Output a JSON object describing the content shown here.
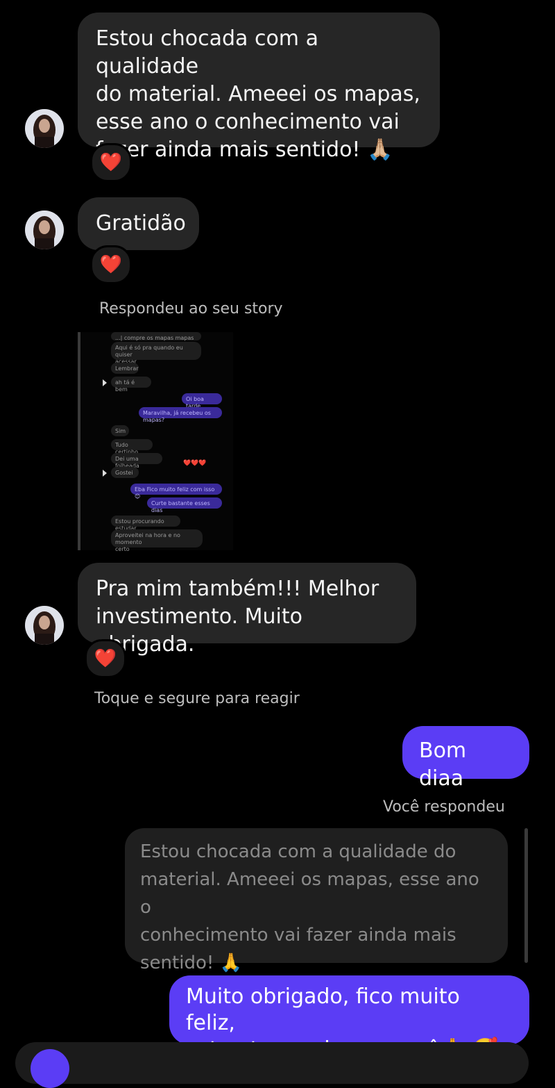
{
  "messages": {
    "m1": "Estou chocada com a qualidade\ndo material. Ameeei os mapas,\nesse ano o conhecimento vai\nfazer ainda mais sentido! 🙏🏼",
    "m2": "Gratidão",
    "m3": "Pra mim também!!! Melhor\ninvestimento. Muito obrigada.",
    "out1": "Bom diaa",
    "out2": "Muito obrigado, fico muito feliz,\nestou torcendo por você🙏 🥰"
  },
  "reaction_emoji": "❤️",
  "labels": {
    "story_reply": "Respondeu ao seu story",
    "hold_hint": "Toque e segure para reagir",
    "you_replied": "Você respondeu"
  },
  "quoted": "Estou chocada com a qualidade do\nmaterial. Ameeei os mapas, esse ano o\nconhecimento vai fazer ainda mais\nsentido! 🙏",
  "story": {
    "lines": [
      "...| compre os mapas mapas",
      "Aqui é só pra quando eu quiser\nacessar",
      "Lembrar",
      "ah tá é bem",
      "Oi boa tarde",
      "Maravilha, já recebeu os mapas?",
      "Sim",
      "Tudo certinho",
      "Dei uma folheada",
      "Gostei",
      "Eba Fico muito feliz com isso😊",
      "Curte bastante esses dias",
      "Estou procurando estudar",
      "Aproveitei na hora e no momento\ncerto"
    ],
    "hearts": "❤️❤️❤️"
  },
  "colors": {
    "accent": "#5b3df5",
    "incoming_bubble": "#262626",
    "background": "#000000"
  }
}
